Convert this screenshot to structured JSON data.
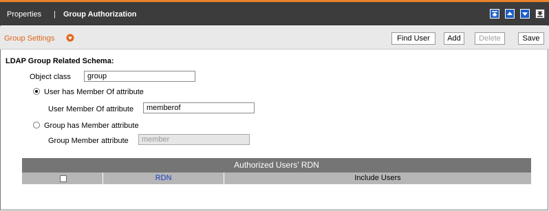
{
  "titlebar": {
    "breadcrumb_root": "Properties",
    "separator": "|",
    "breadcrumb_current": "Group Authorization",
    "icons": [
      "move-top-icon",
      "move-up-icon",
      "move-down-icon",
      "move-bottom-icon"
    ],
    "accent_color": "#e8832a"
  },
  "toolbar": {
    "section_title": "Group Settings",
    "section_icon": "collapse-arrow-icon",
    "find_user_label": "Find User",
    "add_label": "Add",
    "delete_label": "Delete",
    "save_label": "Save"
  },
  "form": {
    "heading": "LDAP Group Related Schema:",
    "object_class_label": "Object class",
    "object_class_value": "group",
    "option_member_of_label": "User has Member Of attribute",
    "member_of_attr_label": "User Member Of attribute",
    "member_of_attr_value": "memberof",
    "option_member_label": "Group has Member attribute",
    "member_attr_label": "Group Member attribute",
    "member_attr_value": "member",
    "selected_option": "User has Member Of attribute"
  },
  "grid": {
    "title": "Authorized Users' RDN",
    "columns": [
      "",
      "RDN",
      "Include Users"
    ]
  }
}
